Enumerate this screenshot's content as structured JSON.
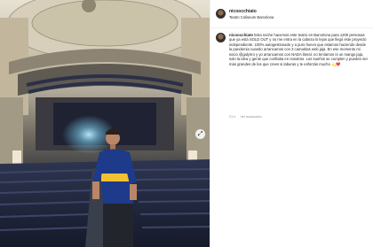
{
  "post": {
    "username": "nicoocchiato",
    "location": "Teatro Coliseum Barcelona",
    "caption": "Esta noche hacemos este teatro en Barcelona para 1200 personas que ya está SOLD OUT y no me entra en la cabeza lo lejos que llegó este proyecto independiente. 100% autogestionado y a puro huevo que estamos haciendo desde la pandemia cuando arrancamos con 3 camaritas web jaja. En ese momento mi socio @galyirro y yo arrancamos con NADA literal, no teníamos ni un mango jaja, solo la idea y gente que confiaba en nosotros. Los sueños se cumplen y pueden ser más grandes de los que crees si laburas y te esforzás mucho 💫❤️",
    "time": "21 h",
    "translation_label": "Ver traducción"
  },
  "colors": {
    "jersey_blue": "#1e3a8a",
    "jersey_yellow": "#f2c230",
    "stage_light": "#7fd3f2"
  },
  "icons": {
    "expand": "expand-arrows-icon"
  }
}
